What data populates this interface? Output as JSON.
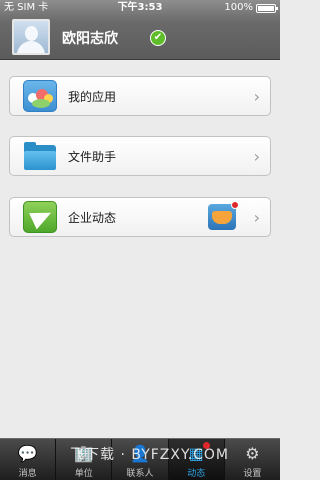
{
  "status": {
    "carrier": "无 SIM 卡",
    "time": "下午3:53",
    "battery": "100%",
    "battery_level": 1.0
  },
  "profile": {
    "name": "欧阳志欣"
  },
  "menu": [
    {
      "label": "我的应用",
      "icon": "apps-icon"
    },
    {
      "label": "文件助手",
      "icon": "folder-icon"
    },
    {
      "label": "企业动态",
      "icon": "paper-plane-icon"
    }
  ],
  "chevron": "›",
  "tabs": [
    {
      "label": "消息",
      "icon": "chat-icon",
      "glyph": "💬"
    },
    {
      "label": "单位",
      "icon": "organization-icon",
      "glyph": "🏢"
    },
    {
      "label": "联系人",
      "icon": "contacts-icon",
      "glyph": "👤"
    },
    {
      "label": "动态",
      "icon": "activity-icon",
      "glyph": "▦"
    },
    {
      "label": "设置",
      "icon": "gear-icon",
      "glyph": "⚙"
    }
  ],
  "watermark": "飞下载 · BYFZXY.COM",
  "colors": {
    "accent": "#2fa3e6",
    "verified": "#5fbd2b",
    "notification": "#e0282b"
  }
}
